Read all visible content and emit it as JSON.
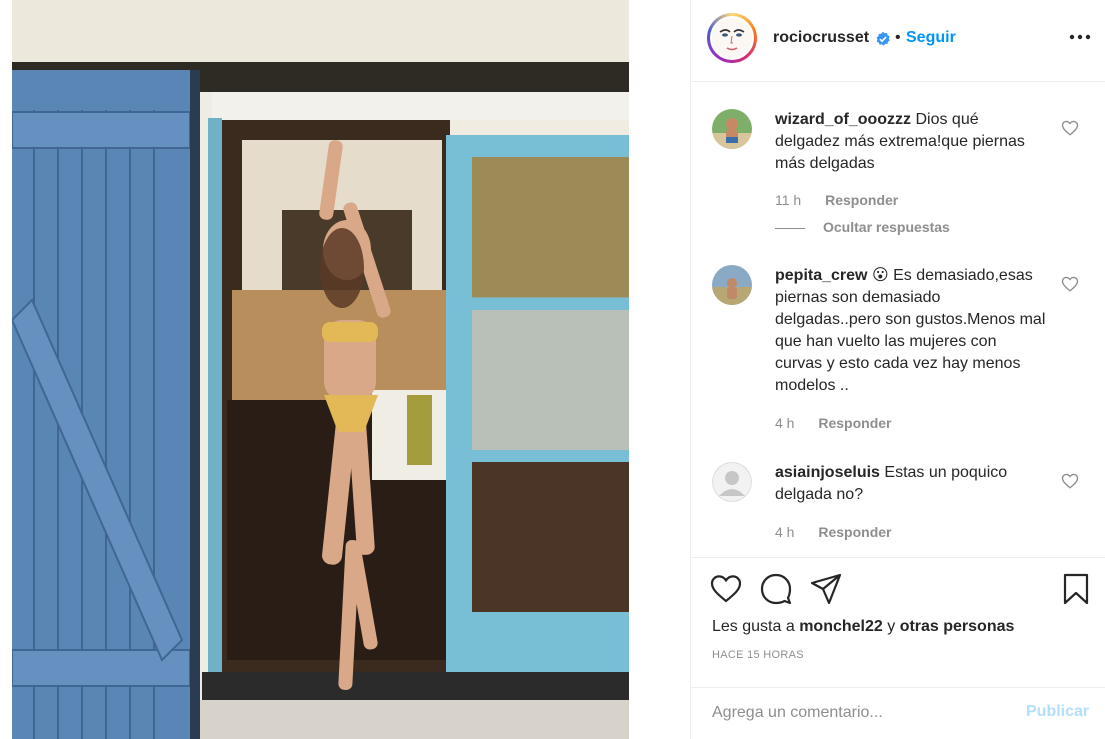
{
  "post": {
    "username": "rociocrusset",
    "separator": "•",
    "follow_label": "Seguir",
    "icons": {
      "verified": "verified-badge-icon",
      "more": "more-options-icon"
    }
  },
  "comments": [
    {
      "username": "wizard_of_ooozzz",
      "text": "Dios qué delgadez más extrema!que piernas más delgadas",
      "time": "11 h",
      "reply_label": "Responder",
      "hide_replies_label": "Ocultar respuestas"
    },
    {
      "username": "pepita_crew",
      "emoji": "😮",
      "text": "Es demasiado,esas piernas son demasiado delgadas..pero son gustos.Menos mal que han vuelto las mujeres con curvas y esto cada vez hay menos modelos ..",
      "time": "4 h",
      "reply_label": "Responder"
    },
    {
      "username": "asiainjoseluis",
      "text": "Estas un poquico delgada no?",
      "time": "4 h",
      "reply_label": "Responder"
    }
  ],
  "actions": {
    "icons": [
      "heart-icon",
      "comment-icon",
      "share-icon",
      "bookmark-icon"
    ]
  },
  "likes": {
    "prefix": "Les gusta a",
    "user": "monchel22",
    "connector": "y",
    "others": "otras personas"
  },
  "time_ago": "HACE 15 HORAS",
  "add_comment": {
    "placeholder": "Agrega un comentario...",
    "publish_label": "Publicar"
  },
  "colors": {
    "link_blue": "#0095f6",
    "publish_disabled": "#b2dffc",
    "muted": "#8e8e8e",
    "door_blue": "#5a86b6"
  }
}
